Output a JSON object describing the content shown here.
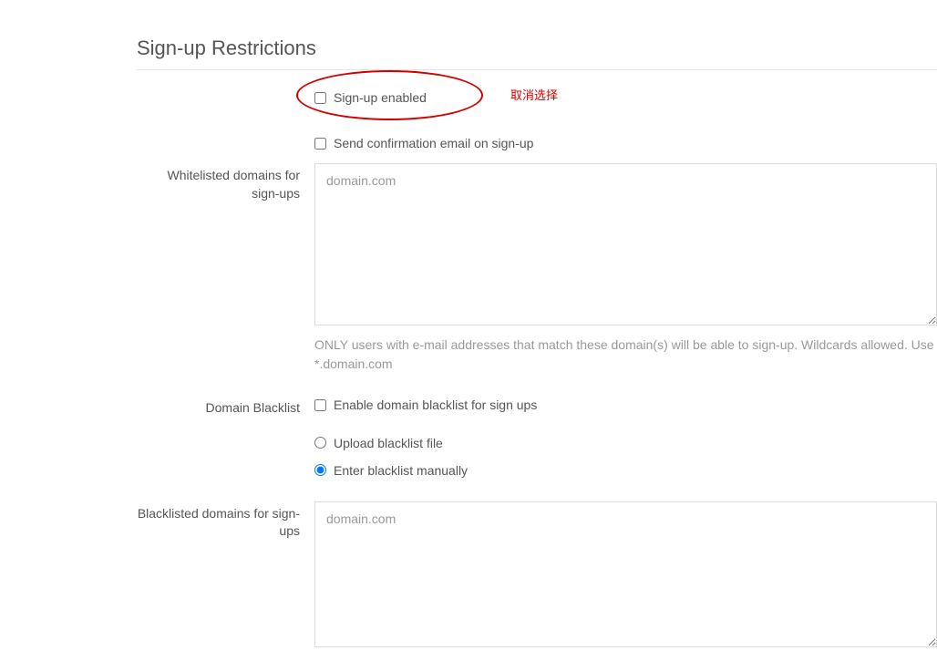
{
  "section": {
    "title": "Sign-up Restrictions"
  },
  "checkboxes": {
    "signup_enabled": {
      "label": "Sign-up enabled",
      "checked": false
    },
    "send_confirmation": {
      "label": "Send confirmation email on sign-up",
      "checked": false
    },
    "enable_domain_blacklist": {
      "label": "Enable domain blacklist for sign ups",
      "checked": false
    }
  },
  "radios": {
    "upload_file": {
      "label": "Upload blacklist file",
      "selected": false
    },
    "enter_manually": {
      "label": "Enter blacklist manually",
      "selected": true
    }
  },
  "labels": {
    "whitelisted": "Whitelisted domains for sign-ups",
    "domain_blacklist": "Domain Blacklist",
    "blacklisted": "Blacklisted domains for sign-ups"
  },
  "textareas": {
    "whitelist": {
      "placeholder": "domain.com",
      "value": ""
    },
    "blacklist": {
      "placeholder": "domain.com",
      "value": ""
    }
  },
  "help": {
    "whitelist": "ONLY users with e-mail addresses that match these domain(s) will be able to sign-up. Wildcards allowed. Use *.domain.com"
  },
  "annotation": {
    "cancel_select": "取消选择"
  }
}
